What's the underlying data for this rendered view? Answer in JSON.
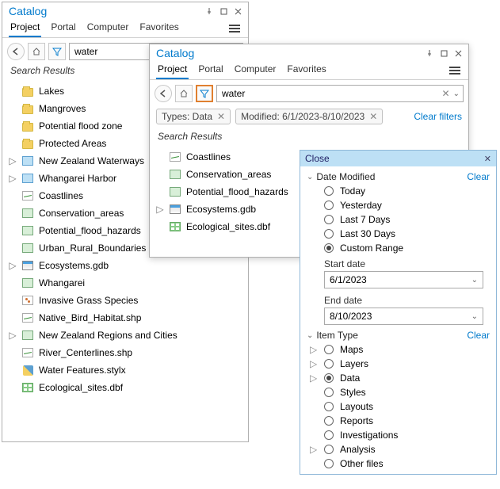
{
  "panelA": {
    "title": "Catalog",
    "tabs": [
      "Project",
      "Portal",
      "Computer",
      "Favorites"
    ],
    "activeTab": 0,
    "search": {
      "value": "water"
    },
    "searchResultsHeader": "Search Results",
    "results": [
      {
        "icon": "folder",
        "label": "Lakes",
        "exp": false
      },
      {
        "icon": "folder",
        "label": "Mangroves",
        "exp": false
      },
      {
        "icon": "folder",
        "label": "Potential flood zone",
        "exp": false
      },
      {
        "icon": "folder",
        "label": "Protected Areas",
        "exp": false
      },
      {
        "icon": "map",
        "label": "New Zealand Waterways",
        "exp": true
      },
      {
        "icon": "map",
        "label": "Whangarei Harbor",
        "exp": true
      },
      {
        "icon": "line",
        "label": "Coastlines",
        "exp": false
      },
      {
        "icon": "poly",
        "label": "Conservation_areas",
        "exp": false
      },
      {
        "icon": "poly",
        "label": "Potential_flood_hazards",
        "exp": false
      },
      {
        "icon": "poly",
        "label": "Urban_Rural_Boundaries",
        "exp": false
      },
      {
        "icon": "gdb",
        "label": "Ecosystems.gdb",
        "exp": true
      },
      {
        "icon": "poly",
        "label": "Whangarei",
        "exp": false
      },
      {
        "icon": "pts",
        "label": "Invasive Grass Species",
        "exp": false
      },
      {
        "icon": "line",
        "label": "Native_Bird_Habitat.shp",
        "exp": false
      },
      {
        "icon": "poly",
        "label": "New Zealand Regions and Cities",
        "exp": true
      },
      {
        "icon": "line",
        "label": "River_Centerlines.shp",
        "exp": false
      },
      {
        "icon": "stylx",
        "label": "Water Features.stylx",
        "exp": false
      },
      {
        "icon": "tbl",
        "label": "Ecological_sites.dbf",
        "exp": false
      }
    ]
  },
  "panelB": {
    "title": "Catalog",
    "tabs": [
      "Project",
      "Portal",
      "Computer",
      "Favorites"
    ],
    "activeTab": 0,
    "search": {
      "value": "water"
    },
    "chips": [
      {
        "label": "Types: Data"
      },
      {
        "label": "Modified: 6/1/2023-8/10/2023"
      }
    ],
    "clearFilters": "Clear filters",
    "searchResultsHeader": "Search Results",
    "results": [
      {
        "icon": "line",
        "label": "Coastlines",
        "exp": false
      },
      {
        "icon": "poly",
        "label": "Conservation_areas",
        "exp": false
      },
      {
        "icon": "poly",
        "label": "Potential_flood_hazards",
        "exp": false
      },
      {
        "icon": "gdb",
        "label": "Ecosystems.gdb",
        "exp": true
      },
      {
        "icon": "tbl",
        "label": "Ecological_sites.dbf",
        "exp": false
      }
    ]
  },
  "filter": {
    "closeLabel": "Close",
    "sections": {
      "dateModified": {
        "label": "Date Modified",
        "clear": "Clear",
        "options": [
          "Today",
          "Yesterday",
          "Last 7 Days",
          "Last 30 Days",
          "Custom Range"
        ],
        "selected": 4,
        "startLabel": "Start date",
        "startValue": "6/1/2023",
        "endLabel": "End date",
        "endValue": "8/10/2023"
      },
      "itemType": {
        "label": "Item Type",
        "clear": "Clear",
        "options": [
          {
            "label": "Maps",
            "exp": true
          },
          {
            "label": "Layers",
            "exp": true
          },
          {
            "label": "Data",
            "exp": true,
            "selected": true
          },
          {
            "label": "Styles",
            "exp": false
          },
          {
            "label": "Layouts",
            "exp": false
          },
          {
            "label": "Reports",
            "exp": false
          },
          {
            "label": "Investigations",
            "exp": false
          },
          {
            "label": "Analysis",
            "exp": true
          },
          {
            "label": "Other files",
            "exp": false
          }
        ]
      }
    }
  }
}
